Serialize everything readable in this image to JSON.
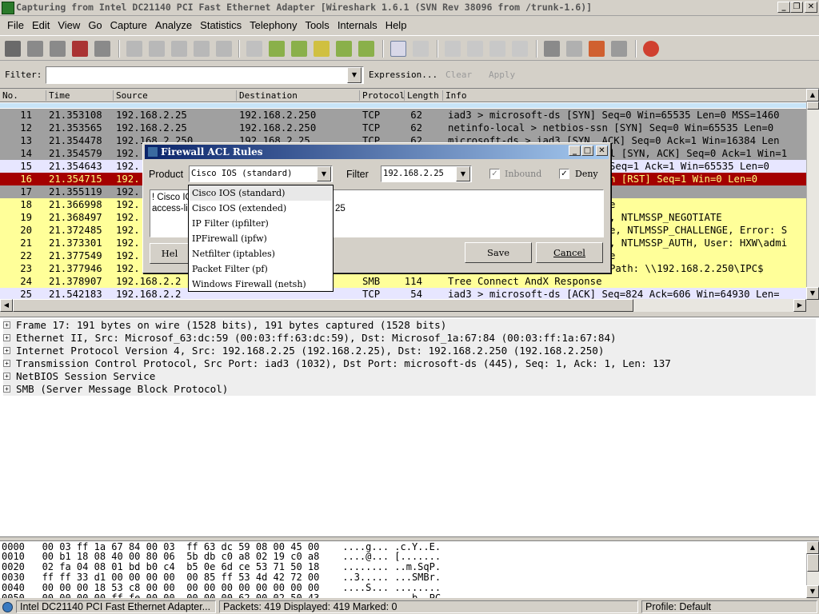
{
  "window": {
    "title": "Capturing from Intel DC21140 PCI Fast Ethernet Adapter    [Wireshark 1.6.1  (SVN Rev 38096 from /trunk-1.6)]",
    "min": "_",
    "max": "❐",
    "close": "✕"
  },
  "menu": [
    "File",
    "Edit",
    "View",
    "Go",
    "Capture",
    "Analyze",
    "Statistics",
    "Telephony",
    "Tools",
    "Internals",
    "Help"
  ],
  "filterbar": {
    "label": "Filter:",
    "value": "",
    "expression": "Expression...",
    "clear": "Clear",
    "apply": "Apply"
  },
  "packet_list": {
    "columns": [
      "No.",
      "Time",
      "Source",
      "Destination",
      "Protocol",
      "Length",
      "Info"
    ],
    "rows": [
      {
        "no": "11",
        "time": "21.353108",
        "src": "192.168.2.25",
        "dst": "192.168.2.250",
        "proto": "TCP",
        "len": "62",
        "info": "iad3 > microsoft-ds [SYN] Seq=0 Win=65535 Len=0 MSS=1460"
      },
      {
        "no": "12",
        "time": "21.353565",
        "src": "192.168.2.25",
        "dst": "192.168.2.250",
        "proto": "TCP",
        "len": "62",
        "info": "netinfo-local > netbios-ssn [SYN] Seq=0 Win=65535 Len=0"
      },
      {
        "no": "13",
        "time": "21.354478",
        "src": "192.168.2.250",
        "dst": "192.168.2.25",
        "proto": "TCP",
        "len": "62",
        "info": "microsoft-ds > iad3 [SYN, ACK] Seq=0 Ack=1 Win=16384 Len"
      },
      {
        "no": "14",
        "time": "21.354579",
        "src": "192.",
        "dst": "",
        "proto": "",
        "len": "",
        "info": "l [SYN, ACK] Seq=0 Ack=1 Win=1"
      },
      {
        "no": "15",
        "time": "21.354643",
        "src": "192.",
        "dst": "",
        "proto": "",
        "len": "",
        "info": "Seq=1 Ack=1 Win=65535 Len=0"
      },
      {
        "no": "16",
        "time": "21.354715",
        "src": "192.",
        "dst": "",
        "proto": "",
        "len": "",
        "info": "n [RST] Seq=1 Win=0 Len=0"
      },
      {
        "no": "17",
        "time": "21.355119",
        "src": "192.",
        "dst": "",
        "proto": "",
        "len": "",
        "info": ""
      },
      {
        "no": "18",
        "time": "21.366998",
        "src": "192.",
        "dst": "",
        "proto": "",
        "len": "",
        "info": "e"
      },
      {
        "no": "19",
        "time": "21.368497",
        "src": "192.",
        "dst": "",
        "proto": "",
        "len": "",
        "info": ", NTLMSSP_NEGOTIATE"
      },
      {
        "no": "20",
        "time": "21.372485",
        "src": "192.",
        "dst": "",
        "proto": "",
        "len": "",
        "info": "e, NTLMSSP_CHALLENGE, Error: S"
      },
      {
        "no": "21",
        "time": "21.373301",
        "src": "192.",
        "dst": "",
        "proto": "",
        "len": "",
        "info": ", NTLMSSP_AUTH, User: HXW\\admi"
      },
      {
        "no": "22",
        "time": "21.377549",
        "src": "192.",
        "dst": "",
        "proto": "",
        "len": "",
        "info": "e"
      },
      {
        "no": "23",
        "time": "21.377946",
        "src": "192.",
        "dst": "",
        "proto": "",
        "len": "",
        "info": "Path: \\\\192.168.2.250\\IPC$"
      },
      {
        "no": "24",
        "time": "21.378907",
        "src": "192.168.2.2",
        "dst": "",
        "proto": "SMB",
        "len": "114",
        "info": "Tree Connect AndX Response"
      },
      {
        "no": "25",
        "time": "21.542183",
        "src": "192.168.2.2",
        "dst": "",
        "proto": "TCP",
        "len": "54",
        "info": "iad3 > microsoft-ds [ACK] Seq=824 Ack=606 Win=64930 Len="
      }
    ]
  },
  "details": [
    "Frame 17: 191 bytes on wire (1528 bits), 191 bytes captured (1528 bits)",
    "Ethernet II, Src: Microsof_63:dc:59 (00:03:ff:63:dc:59), Dst: Microsof_1a:67:84 (00:03:ff:1a:67:84)",
    "Internet Protocol Version 4, Src: 192.168.2.25 (192.168.2.25), Dst: 192.168.2.250 (192.168.2.250)",
    "Transmission Control Protocol, Src Port: iad3 (1032), Dst Port: microsoft-ds (445), Seq: 1, Ack: 1, Len: 137",
    "NetBIOS Session Service",
    "SMB (Server Message Block Protocol)"
  ],
  "bytes": [
    "0000   00 03 ff 1a 67 84 00 03  ff 63 dc 59 08 00 45 00    ....g... .c.Y..E.",
    "0010   00 b1 18 08 40 00 80 06  5b db c0 a8 02 19 c0 a8    ....@... [.......",
    "0020   02 fa 04 08 01 bd b0 c4  b5 0e 6d ce 53 71 50 18    ........ ..m.SqP.",
    "0030   ff ff 33 d1 00 00 00 00  00 85 ff 53 4d 42 72 00    ..3..... ...SMBr.",
    "0040   00 00 00 18 53 c8 00 00  00 00 00 00 00 00 00 00    ....S... ........",
    "0050   00 00 00 00 ff fe 00 00  00 00 00 62 00 02 50 43    ........ ...b..PC"
  ],
  "statusbar": {
    "interface": "Intel DC21140 PCI Fast Ethernet Adapter...",
    "packets": "Packets: 419 Displayed: 419 Marked: 0",
    "profile": "Profile: Default"
  },
  "dialog": {
    "title": "Firewall ACL Rules",
    "product_label": "Product",
    "product_value": "Cisco IOS (standard)",
    "filter_label": "Filter",
    "filter_value": "192.168.2.25",
    "inbound_label": "Inbound",
    "inbound_checked": true,
    "deny_label": "Deny",
    "deny_checked": true,
    "rule_line1": "! Cisco IO",
    "rule_line2": "access-lis",
    "rule_line2_tail": "25",
    "help_label": "Hel",
    "save_label": "Save",
    "cancel_label": "Cancel",
    "product_options": [
      "Cisco IOS (standard)",
      "Cisco IOS (extended)",
      "IP Filter (ipfilter)",
      "IPFirewall (ipfw)",
      "Netfilter (iptables)",
      "Packet Filter (pf)",
      "Windows Firewall (netsh)"
    ]
  },
  "colors": {
    "row_gray": "#a0a0a0",
    "row_yellow": "#ffff99",
    "row_red": "#a40000",
    "row_lavender": "#e7e6ff",
    "selection_blue": "#0a246a"
  }
}
